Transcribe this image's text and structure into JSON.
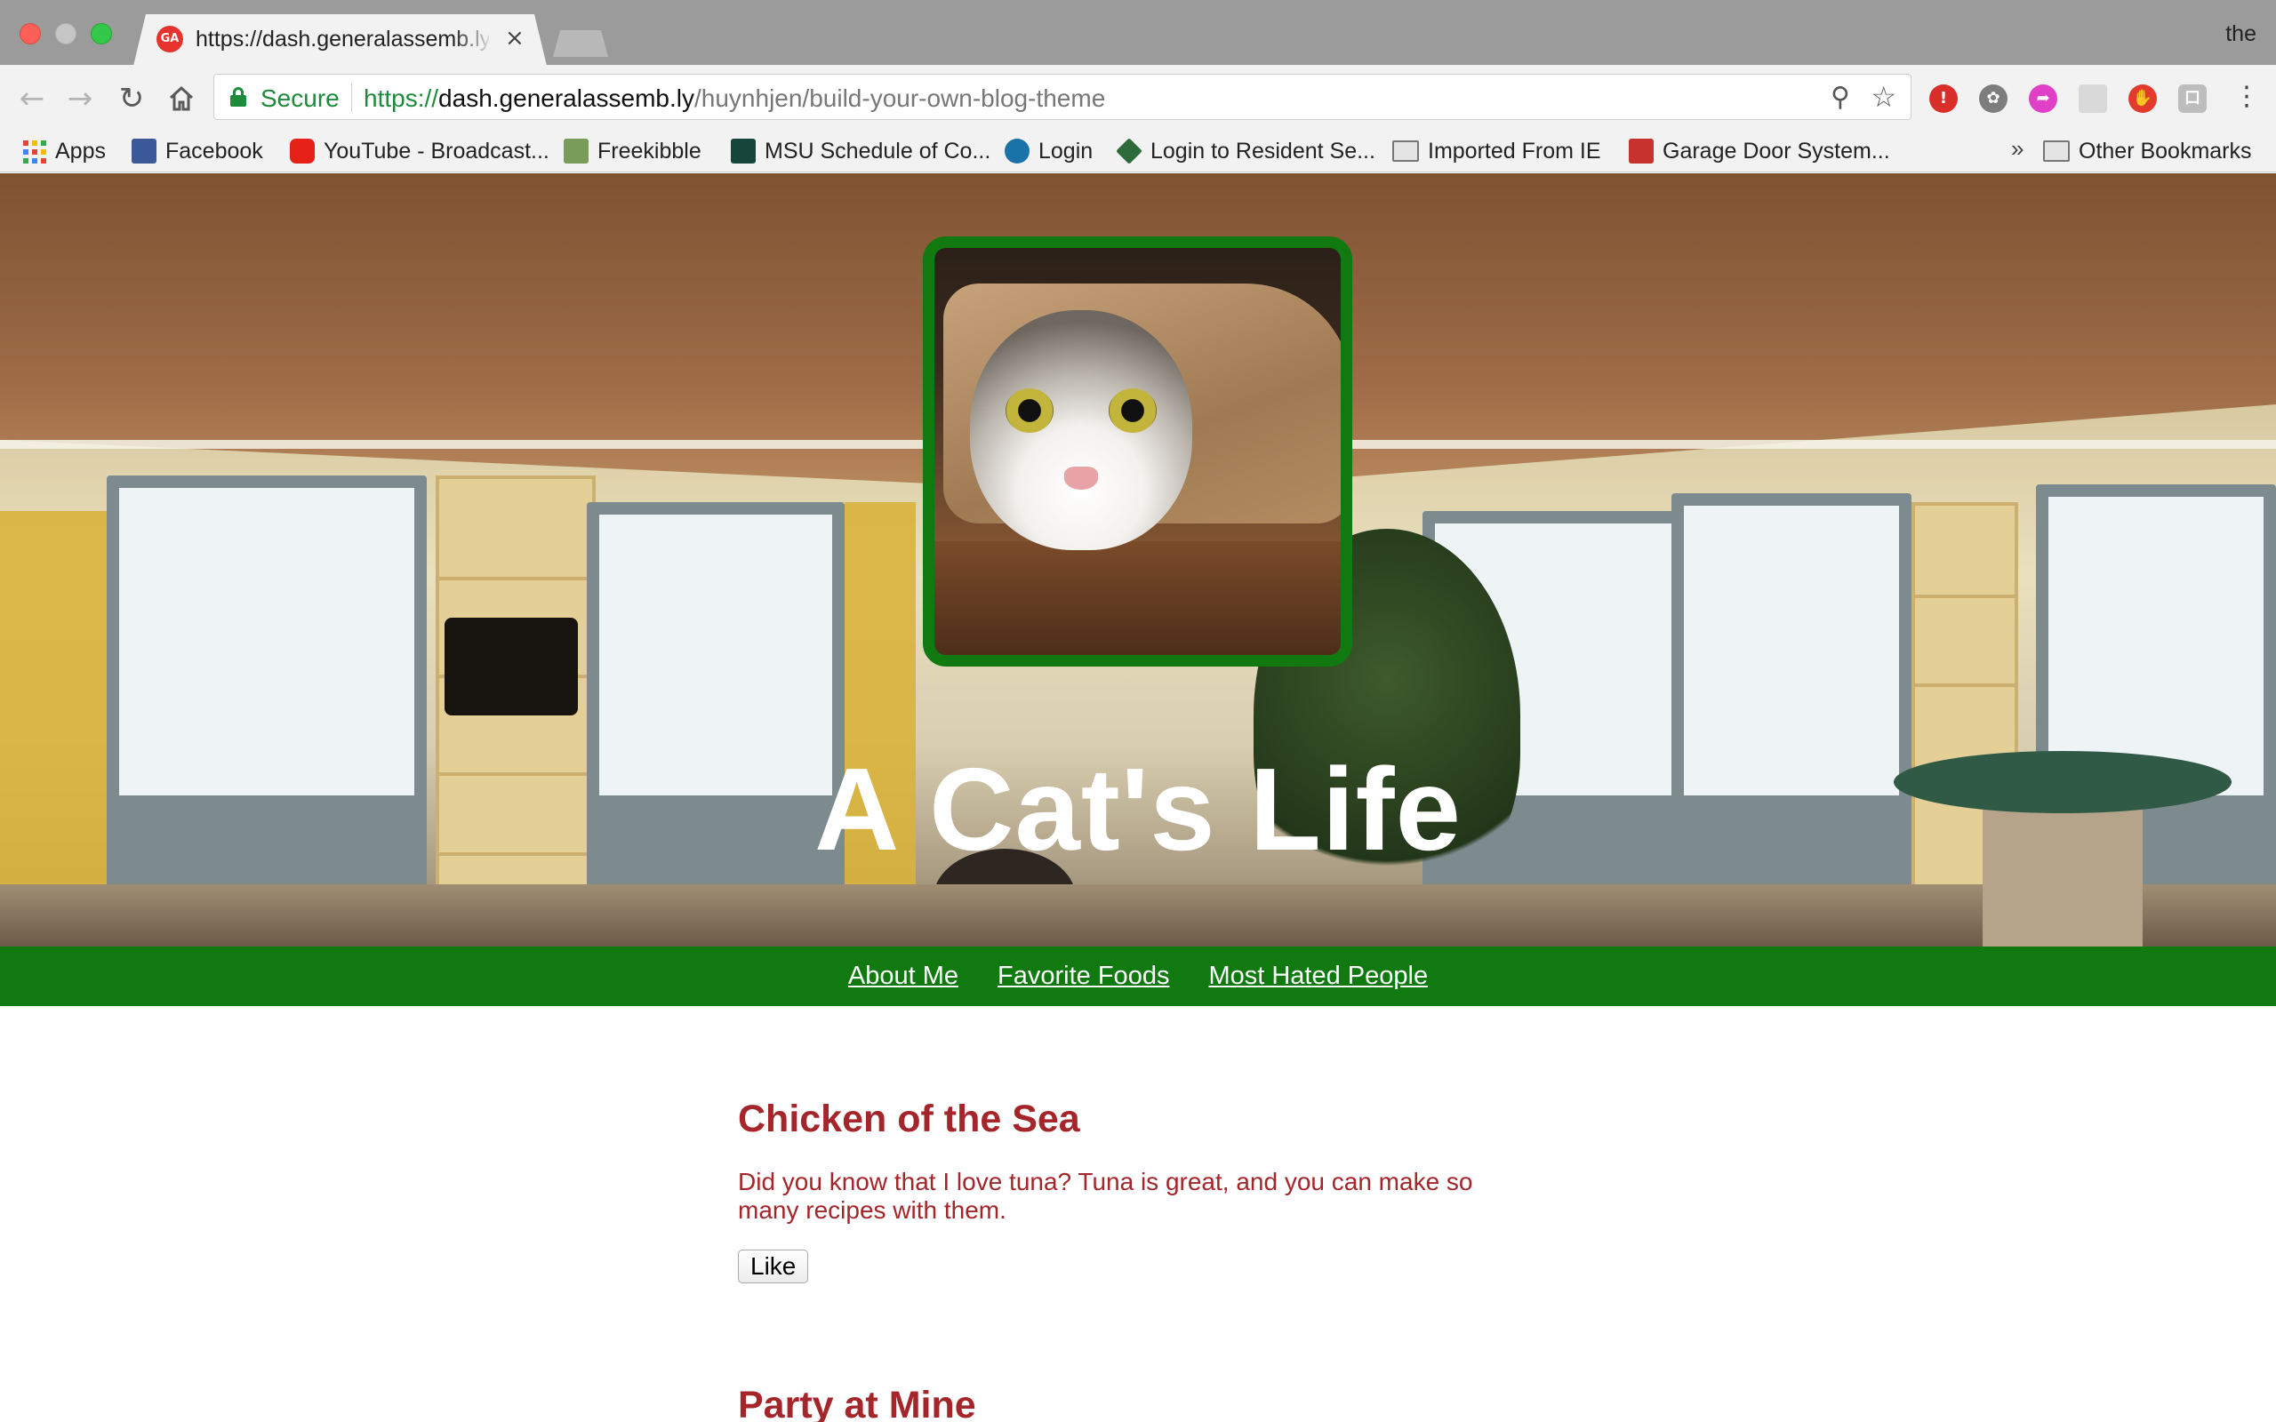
{
  "browser": {
    "tab": {
      "favicon_text": "GA",
      "title": "https://dash.generalassemb.ly/huynhjen/build-your-own-blog-theme",
      "close_glyph": "×"
    },
    "profile_name": "the",
    "toolbar": {
      "back_icon": "arrow-left-icon",
      "forward_icon": "arrow-right-icon",
      "reload_icon": "reload-icon",
      "home_icon": "home-icon"
    },
    "omnibox": {
      "security_label": "Secure",
      "url_scheme": "https://",
      "url_host": "dash.generalassemb.ly",
      "url_path": "/huynhjen/build-your-own-blog-theme"
    },
    "extensions": [
      "ublock-icon",
      "film-reel-icon",
      "pink-arrow-icon",
      "blank-extension-icon",
      "adblock-hand-icon",
      "translate-icon"
    ],
    "bookmarks": [
      {
        "label": "Apps",
        "icon": "apps-grid-icon"
      },
      {
        "label": "Facebook",
        "icon": "facebook-icon",
        "color": "#3b5998"
      },
      {
        "label": "YouTube - Broadcast...",
        "icon": "youtube-icon",
        "color": "#e62117"
      },
      {
        "label": "Freekibble",
        "icon": "freekibble-icon",
        "color": "#7a9c5a"
      },
      {
        "label": "MSU Schedule of Co...",
        "icon": "msu-spartan-icon",
        "color": "#18453b"
      },
      {
        "label": "Login",
        "icon": "p-login-icon",
        "color": "#1a73a8"
      },
      {
        "label": "Login to Resident Se...",
        "icon": "diamond-icon",
        "color": "#2e6b3a"
      },
      {
        "label": "Imported From IE",
        "icon": "folder-icon"
      },
      {
        "label": "Garage Door System...",
        "icon": "garage-door-icon",
        "color": "#c8322e"
      }
    ],
    "bookmarks_overflow": "»",
    "other_bookmarks": "Other Bookmarks"
  },
  "page": {
    "site_title": "A Cat's Life",
    "nav": [
      "About Me",
      "Favorite Foods",
      "Most Hated People"
    ],
    "posts": [
      {
        "title": "Chicken of the Sea",
        "body": "Did you know that I love tuna? Tuna is great, and you can make so many recipes with them.",
        "like_label": "Like"
      },
      {
        "title": "Party at Mine"
      }
    ]
  },
  "colors": {
    "accent_green": "#107a10",
    "post_red": "#a4252a",
    "secure_green": "#1d8a3c"
  }
}
